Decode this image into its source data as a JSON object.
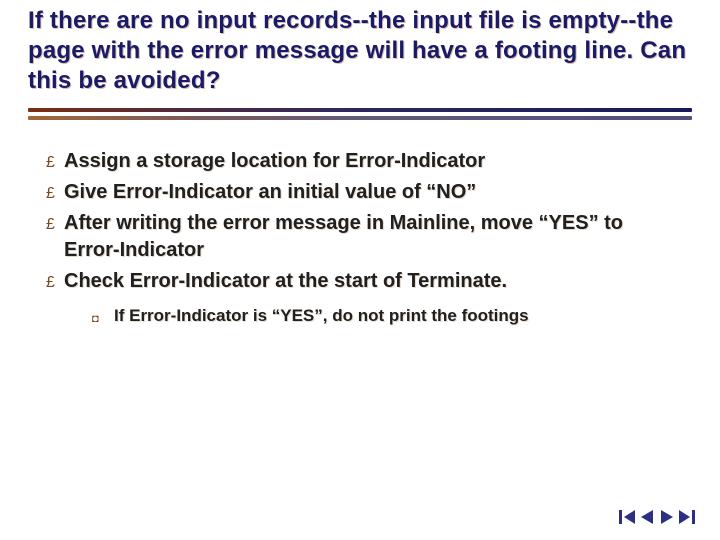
{
  "colors": {
    "title_color": "#1a1a6a",
    "bullet_icon_color": "#7a4722",
    "rule_top_gradient": [
      "#7a2e12",
      "#4d2a40",
      "#2d2760",
      "#191a5a"
    ],
    "rule_bottom_gradient": [
      "#a06838",
      "#7a5a5a",
      "#615a78",
      "#504f7a"
    ],
    "nav_icon_color": "#2d2f84"
  },
  "slide": {
    "title": "If there are no input records--the input file is empty--the page with the error message will have a footing line.  Can this be avoided?",
    "bullets": [
      {
        "text": "Assign a storage location for Error-Indicator"
      },
      {
        "text": "Give Error-Indicator an initial value of “NO”"
      },
      {
        "text": "After writing the error message in Mainline, move “YES” to Error-Indicator"
      },
      {
        "text": "Check Error-Indicator at the start of Terminate."
      }
    ],
    "sub_bullets": [
      {
        "parent_index": 3,
        "text": "If Error-Indicator is “YES”, do not print the footings"
      }
    ]
  },
  "nav": {
    "first": "first-slide",
    "prev": "previous-slide",
    "next": "next-slide",
    "last": "last-slide"
  }
}
